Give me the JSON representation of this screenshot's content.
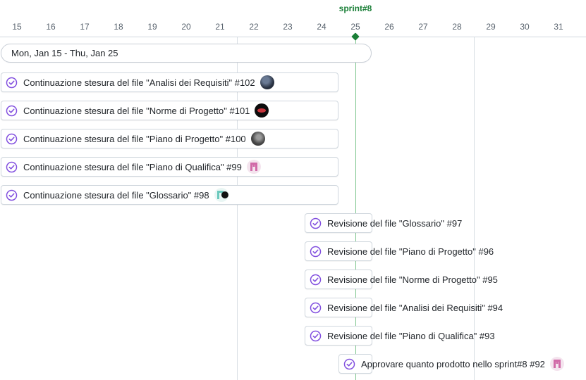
{
  "header": {
    "days": [
      "15",
      "16",
      "17",
      "18",
      "19",
      "20",
      "21",
      "22",
      "23",
      "24",
      "25",
      "26",
      "27",
      "28",
      "29",
      "30",
      "31"
    ],
    "sprint_label": "sprint#8"
  },
  "range": {
    "label": "Mon, Jan 15 - Thu, Jan 25"
  },
  "items": [
    {
      "title": "Continuazione stesura del file \"Analisi dei Requisiti\" #102",
      "avatar": "avatar-dark-icon"
    },
    {
      "title": "Continuazione stesura del file \"Norme di Progetto\" #101",
      "avatar": "avatar-black-red-icon"
    },
    {
      "title": "Continuazione stesura del file \"Piano di Progetto\" #100",
      "avatar": "avatar-photo-icon"
    },
    {
      "title": "Continuazione stesura del file \"Piano di Qualifica\" #99",
      "avatar": "avatar-pink-identicon"
    },
    {
      "title": "Continuazione stesura del file \"Glossario\" #98",
      "avatar": "avatar-teal-identicon"
    },
    {
      "title": "Revisione del file \"Glossario\" #97"
    },
    {
      "title": "Revisione del file \"Piano di Progetto\" #96"
    },
    {
      "title": "Revisione del file \"Norme di Progetto\" #95"
    },
    {
      "title": "Revisione del file \"Analisi dei Requisiti\" #94"
    },
    {
      "title": "Revisione del file \"Piano di Qualifica\" #93"
    },
    {
      "title": "Approvare quanto prodotto nello sprint#8 #92",
      "avatar": "avatar-pink-identicon"
    }
  ],
  "colors": {
    "sprint": "#1a7f37",
    "check_icon": "#8250df",
    "border": "#d0d7de"
  }
}
